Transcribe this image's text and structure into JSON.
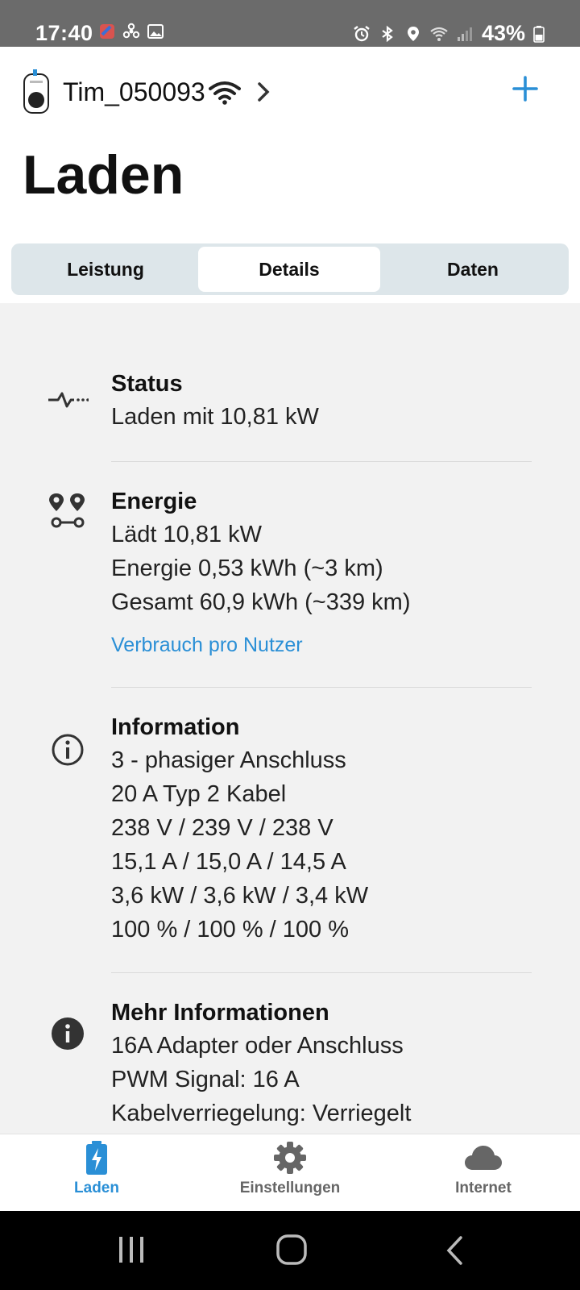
{
  "status_bar": {
    "time": "17:40",
    "battery": "43%",
    "notification_icons": [
      "app-icon",
      "fan-icon",
      "image-icon"
    ],
    "system_icons": [
      "alarm-icon",
      "bluetooth-icon",
      "location-icon",
      "wifi-icon",
      "signal-icon",
      "battery-icon"
    ]
  },
  "header": {
    "device_name": "Tim_050093",
    "title": "Laden"
  },
  "tabs": [
    {
      "label": "Leistung",
      "selected": false
    },
    {
      "label": "Details",
      "selected": true
    },
    {
      "label": "Daten",
      "selected": false
    }
  ],
  "sections": {
    "status": {
      "icon": "pulse-icon",
      "title": "Status",
      "lines": [
        "Laden mit 10,81 kW"
      ]
    },
    "energie": {
      "icon": "route-icon",
      "title": "Energie",
      "lines": [
        "Lädt 10,81 kW",
        "Energie 0,53 kWh (~3 km)",
        "Gesamt 60,9 kWh (~339 km)"
      ],
      "link": "Verbrauch pro Nutzer"
    },
    "information": {
      "icon": "info-outline-icon",
      "title": "Information",
      "lines": [
        "3 - phasiger Anschluss",
        "20 A Typ 2 Kabel",
        "238 V / 239 V / 238 V",
        "15,1 A / 15,0 A / 14,5 A",
        "3,6 kW / 3,6 kW / 3,4 kW",
        "100 % / 100 % / 100 %"
      ]
    },
    "mehr": {
      "icon": "info-filled-icon",
      "title": "Mehr Informationen",
      "lines": [
        "16A Adapter oder Anschluss",
        "PWM Signal: 16 A",
        "Kabelverriegelung: Verriegelt"
      ]
    }
  },
  "bottom_nav": [
    {
      "label": "Laden",
      "icon": "battery-charging-icon",
      "active": true
    },
    {
      "label": "Einstellungen",
      "icon": "gear-icon",
      "active": false
    },
    {
      "label": "Internet",
      "icon": "cloud-icon",
      "active": false
    }
  ],
  "colors": {
    "accent": "#2a8fd6",
    "background": "#f2f2f2",
    "segment_bg": "#dde6ea"
  }
}
